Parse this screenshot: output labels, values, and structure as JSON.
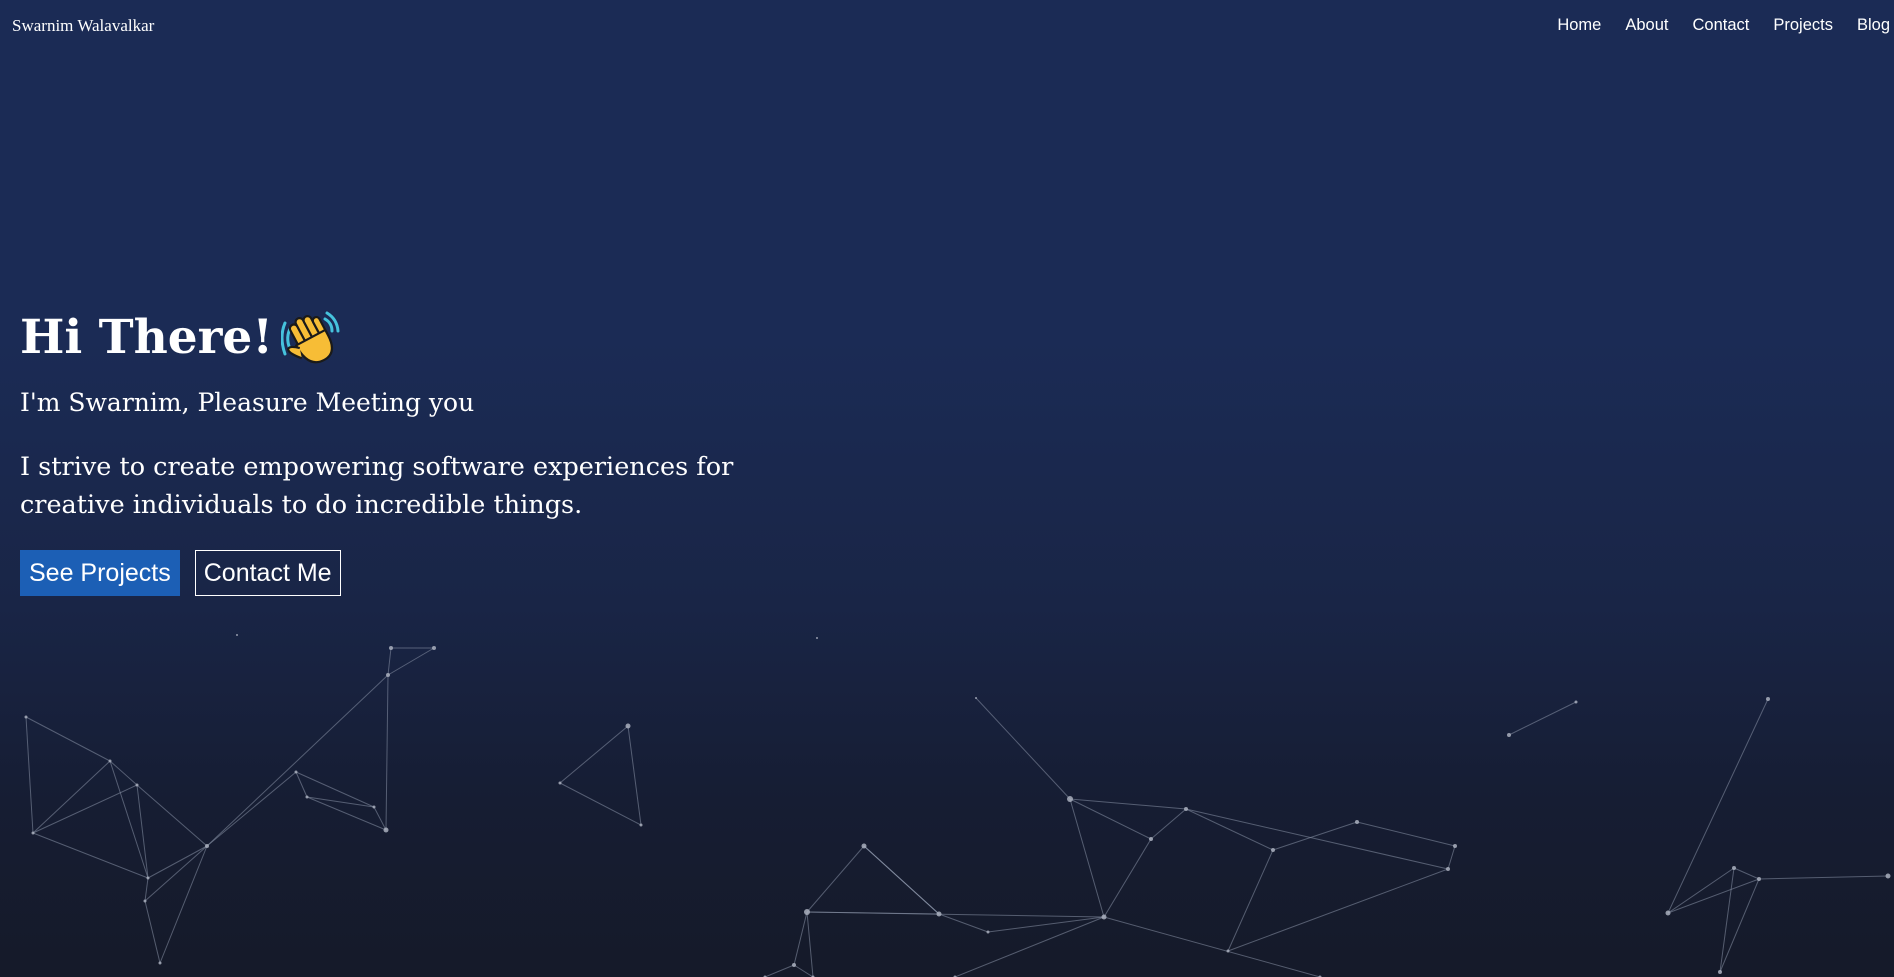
{
  "navbar": {
    "brand": "Swarnim Walavalkar",
    "links": [
      "Home",
      "About",
      "Contact",
      "Projects",
      "Blog"
    ]
  },
  "hero": {
    "greeting": "Hi There!",
    "greeting_icon": "waving-hand-icon",
    "subtitle": "I'm Swarnim, Pleasure Meeting you",
    "description": "I strive to create empowering software experiences for creative individuals to do incredible things.",
    "primary_button": "See Projects",
    "secondary_button": "Contact Me"
  },
  "colors": {
    "background_top": "#1b2b55",
    "background_bottom": "#151a29",
    "primary_button": "#1c5fb5",
    "text": "#ffffff",
    "network_line": "#8a93a8",
    "network_node": "#a9afbd"
  },
  "background_decoration": "particle-network"
}
